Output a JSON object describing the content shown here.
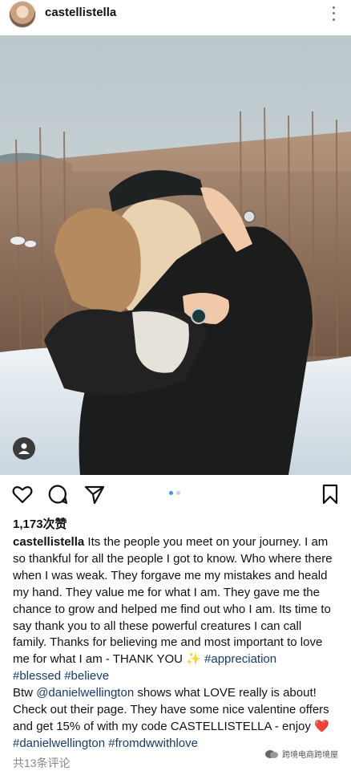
{
  "post": {
    "username": "castellistella",
    "likes_text": "1,173次赞",
    "comments_text": "共13条评论",
    "carousel_count": 2,
    "carousel_active": 0
  },
  "caption": {
    "username": "castellistella",
    "body_part1": " Its the people you meet on your journey. I am so thankful for all the people I got to know. Who where there when I was weak. They forgave me my mistakes and heald my hand. They value me for what I am. They gave me the chance to grow and helped me find out who I am. Its time to say thank you to all these powerful creatures I can call family. Thanks for believing me and most important to love me for what I am - THANK YOU ",
    "sparkle": "✨",
    "tag_appreciation": "#appreciation",
    "tag_blessed": "#blessed",
    "tag_believe": "#believe",
    "btw": "Btw ",
    "mention_dw": "@danielwellington",
    "body_part2": " shows what LOVE really is about! Check out their page. They have some nice valentine offers and get 15% of with my code CASTELLISTELLA - enjoy ",
    "heart": "❤️",
    "tag_danielwellington": "#danielwellington",
    "tag_fromdwwithlove": "#fromdwwithlove"
  },
  "watermark": {
    "text": "跨境电商跨境屋"
  },
  "icons": {
    "like": "heart-outline-icon",
    "comment": "speech-bubble-icon",
    "share": "paper-plane-icon",
    "save": "bookmark-icon",
    "more": "vertical-dots-icon",
    "tags": "person-tag-icon"
  },
  "colors": {
    "hashtag": "#183b6e",
    "carousel_active": "#3897f0",
    "secondary_text": "#888888"
  }
}
